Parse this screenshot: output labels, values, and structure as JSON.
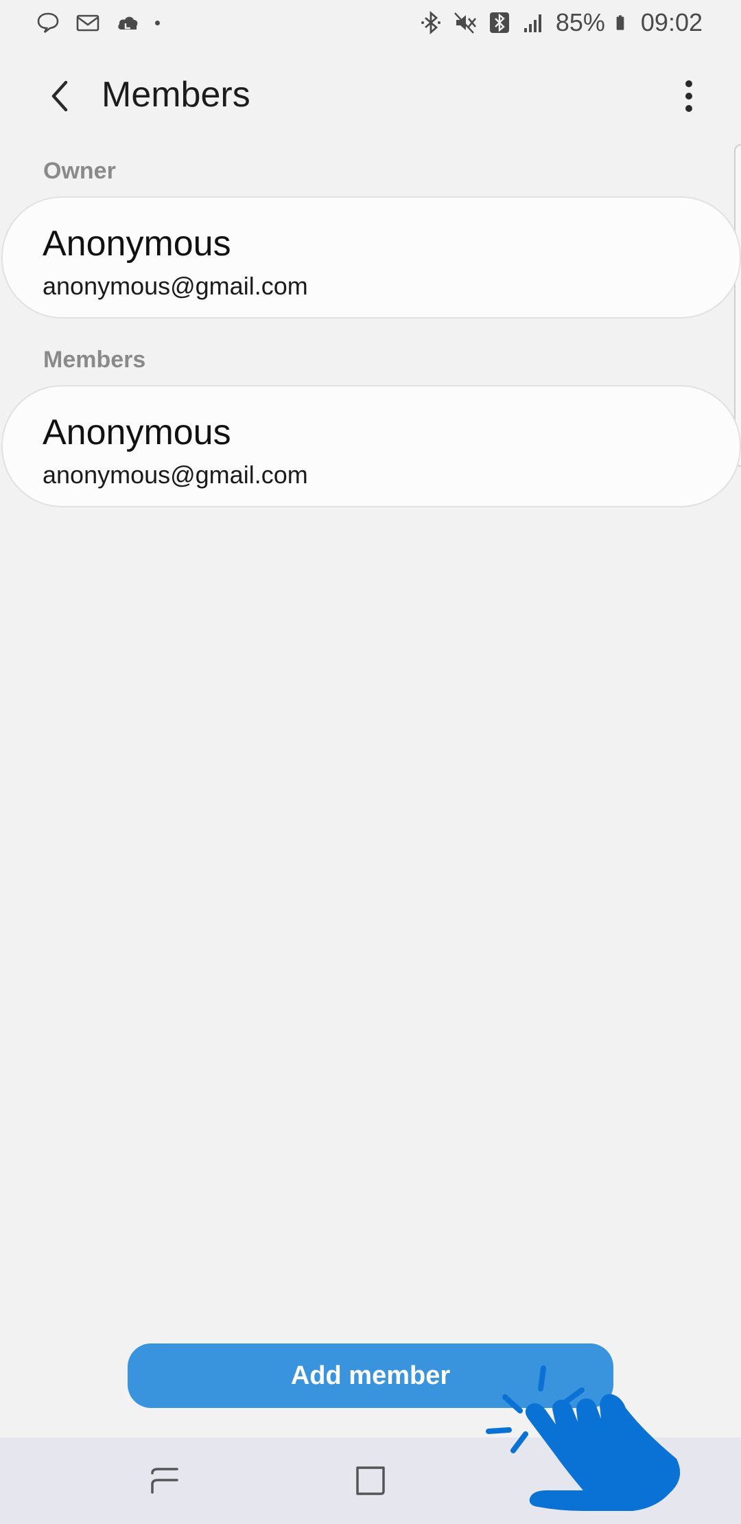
{
  "status_bar": {
    "battery": "85%",
    "time": "09:02",
    "left_icons": [
      "chat-bubble-icon",
      "mail-icon",
      "cloud-icon",
      "notification-dot-icon"
    ],
    "right_icons": [
      "bluetooth-icon",
      "mute-icon",
      "bluetooth-box-icon",
      "signal-icon",
      "battery-icon"
    ]
  },
  "app_bar": {
    "title": "Members",
    "back_icon": "chevron-left-icon",
    "menu_icon": "more-vertical-icon"
  },
  "sections": {
    "owner": {
      "label": "Owner",
      "name": "Anonymous",
      "email": "anonymous@gmail.com"
    },
    "members": {
      "label": "Members",
      "items": [
        {
          "name": "Anonymous",
          "email": "anonymous@gmail.com"
        }
      ]
    }
  },
  "add_button": {
    "label": "Add member",
    "color": "#3a93dd"
  },
  "nav_bar": {
    "icons": [
      "recents-icon",
      "home-icon"
    ]
  },
  "overlay": {
    "icon": "tap-hand-icon",
    "color": "#0a72d4"
  }
}
